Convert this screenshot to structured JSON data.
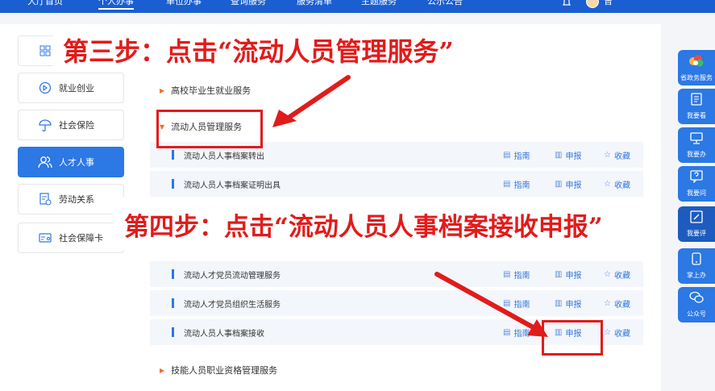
{
  "nav": {
    "items": [
      "大厅首页",
      "个人办事",
      "单位办事",
      "查询服务",
      "服务清单",
      "主题服务",
      "公示公告"
    ],
    "user": "曾"
  },
  "sidebar": {
    "items": [
      {
        "label": "",
        "icon": "grid-icon"
      },
      {
        "label": "就业创业",
        "icon": "employment-icon"
      },
      {
        "label": "社会保险",
        "icon": "umbrella-icon"
      },
      {
        "label": "人才人事",
        "icon": "people-icon",
        "active": true
      },
      {
        "label": "劳动关系",
        "icon": "document-icon"
      },
      {
        "label": "社会保障卡",
        "icon": "card-icon"
      }
    ]
  },
  "content": {
    "cat1": "高校毕业生就业服务",
    "cat2": "流动人员管理服务",
    "cat3": "技能人员职业资格管理服务",
    "rows": [
      {
        "name": "流动人员人事档案转出",
        "guide": "指南",
        "apply": "申报",
        "fav": "收藏"
      },
      {
        "name": "流动人员人事档案证明出具",
        "guide": "指南",
        "apply": "申报",
        "fav": "收藏"
      },
      {
        "name": "流动人才党员流动管理服务",
        "guide": "指南",
        "apply": "申报",
        "fav": "收藏"
      },
      {
        "name": "流动人才党员组织生活服务",
        "guide": "指南",
        "apply": "申报",
        "fav": "收藏"
      },
      {
        "name": "流动人员人事档案接收",
        "guide": "指南",
        "apply": "申报",
        "fav": "收藏"
      }
    ]
  },
  "annotations": {
    "step3": "第三步：点击“流动人员管理服务”",
    "step4": "第四步：点击“流动人员人事档案接收申报”"
  },
  "right_toolbar": [
    {
      "label": "省政务服务",
      "icon": "logo-icon"
    },
    {
      "label": "我要看",
      "icon": "book-icon"
    },
    {
      "label": "我要办",
      "icon": "monitor-icon"
    },
    {
      "label": "我要问",
      "icon": "question-icon"
    },
    {
      "label": "我要评",
      "icon": "edit-icon"
    },
    {
      "label": "掌上办",
      "icon": "phone-icon"
    },
    {
      "label": "公众号",
      "icon": "wechat-icon"
    }
  ],
  "colors": {
    "primary": "#2c78e4",
    "annotation_red": "#e21b1b",
    "triangle": "#e8732c"
  }
}
